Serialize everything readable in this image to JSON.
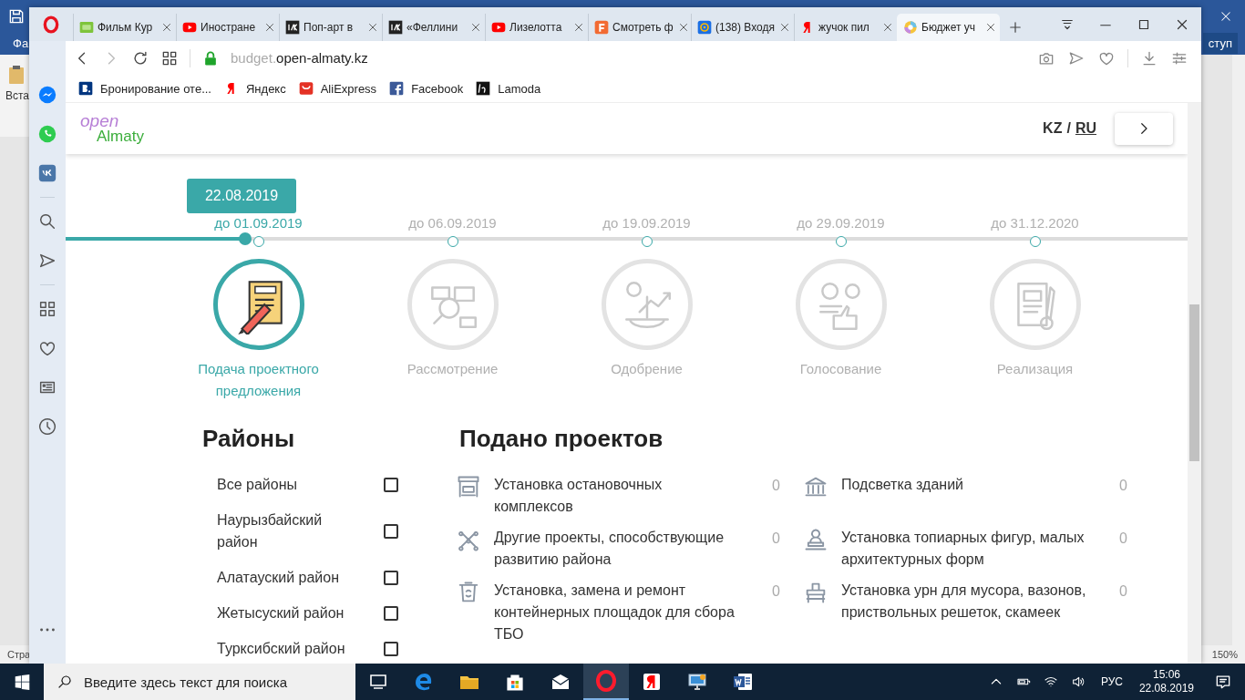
{
  "background_window": {
    "menu_tab": "Фа",
    "ribbon_button": "ступ",
    "paste_label": "Вста",
    "status_text": "Стра",
    "zoom": "150%"
  },
  "browser": {
    "tabs": [
      {
        "label": "Фильм Кур",
        "kind": "hd",
        "selected": false
      },
      {
        "label": "Иностране",
        "kind": "youtube",
        "selected": false
      },
      {
        "label": "Поп-арт в",
        "kind": "ik",
        "selected": false
      },
      {
        "label": "«Феллини",
        "kind": "ik",
        "selected": false
      },
      {
        "label": "Лизелотта",
        "kind": "youtube",
        "selected": false
      },
      {
        "label": "Смотреть ф",
        "kind": "fire",
        "selected": false
      },
      {
        "label": "(138) Входя",
        "kind": "mail",
        "selected": false
      },
      {
        "label": "жучок пил",
        "kind": "yandex",
        "selected": false
      },
      {
        "label": "Бюджет уч",
        "kind": "site",
        "selected": true
      }
    ],
    "address": {
      "subdomain": "budget.",
      "domain": "open-almaty.kz",
      "secure": true
    },
    "bookmarks": [
      {
        "label": "Бронирование оте...",
        "kind": "booking"
      },
      {
        "label": "Яндекс",
        "kind": "yandex"
      },
      {
        "label": "AliExpress",
        "kind": "aliexpress"
      },
      {
        "label": "Facebook",
        "kind": "facebook"
      },
      {
        "label": "Lamoda",
        "kind": "lamoda"
      }
    ]
  },
  "site": {
    "logo": {
      "top": "open",
      "bottom": "Almaty"
    },
    "languages": [
      {
        "label": "KZ",
        "selected": false
      },
      {
        "label": "RU",
        "selected": true
      }
    ],
    "language_separator": "/",
    "timeline": {
      "current_date": "22.08.2019",
      "level": 0.16,
      "steps": [
        {
          "deadline": "до 01.09.2019",
          "label": "Подача проектного предложения",
          "kind": "proposal",
          "active": true
        },
        {
          "deadline": "до 06.09.2019",
          "label": "Рассмотрение",
          "kind": "review",
          "active": false
        },
        {
          "deadline": "до 19.09.2019",
          "label": "Одобрение",
          "kind": "approval",
          "active": false
        },
        {
          "deadline": "до 29.09.2019",
          "label": "Голосование",
          "kind": "voting",
          "active": false
        },
        {
          "deadline": "до 31.12.2020",
          "label": "Реализация",
          "kind": "implementation",
          "active": false
        }
      ]
    },
    "districts": {
      "title": "Районы",
      "items": [
        {
          "label": "Все районы",
          "checked": false
        },
        {
          "label": "Наурызбайский район",
          "checked": false
        },
        {
          "label": "Алатауский район",
          "checked": false
        },
        {
          "label": "Жетысуский район",
          "checked": false
        },
        {
          "label": "Турксибский район",
          "checked": false
        }
      ]
    },
    "projects": {
      "title": "Подано проектов",
      "items": [
        {
          "label": "Установка остановочных комплексов",
          "count": "0",
          "kind": "bus-stop"
        },
        {
          "label": "Подсветка зданий",
          "count": "0",
          "kind": "building"
        },
        {
          "label": "Другие проекты, способствующие развитию района",
          "count": "0",
          "kind": "network"
        },
        {
          "label": "Установка топиарных фигур, малых архитектурных форм",
          "count": "0",
          "kind": "statue"
        },
        {
          "label": "Установка, замена и ремонт контейнерных площадок для сбора ТБО",
          "count": "0",
          "kind": "trash-bin"
        },
        {
          "label": "Установка урн для мусора, вазонов, приствольных решеток, скамеек",
          "count": "0",
          "kind": "bench"
        }
      ]
    }
  },
  "taskbar": {
    "search_placeholder": "Введите здесь текст для поиска",
    "apps": [
      {
        "kind": "task-view",
        "selected": false
      },
      {
        "kind": "edge",
        "selected": false
      },
      {
        "kind": "folder",
        "selected": false
      },
      {
        "kind": "store",
        "selected": false
      },
      {
        "kind": "mail",
        "selected": false
      },
      {
        "kind": "opera",
        "selected": true
      },
      {
        "kind": "yandex",
        "selected": false
      },
      {
        "kind": "monitor",
        "selected": false
      },
      {
        "kind": "word",
        "selected": false
      }
    ],
    "language": "РУС",
    "time": "15:06",
    "date": "22.08.2019"
  }
}
